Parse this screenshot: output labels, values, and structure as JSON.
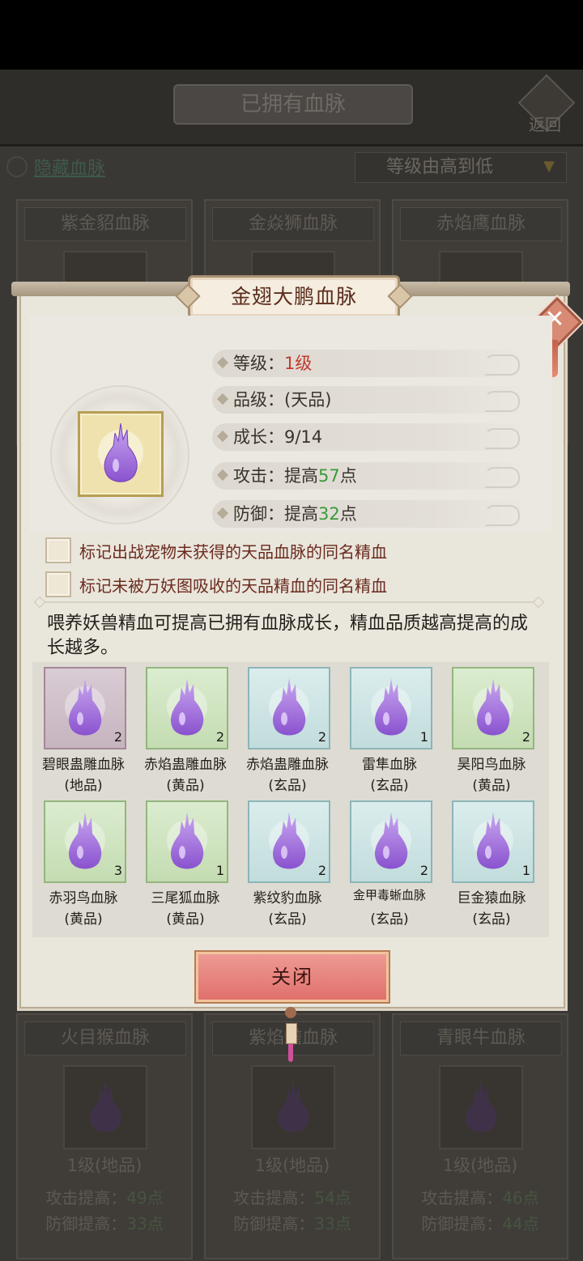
{
  "background": {
    "title": "已拥有血脉",
    "back_label": "返回",
    "hidden_toggle": "隐藏血脉",
    "sort": "等级由高到低",
    "top_cards": [
      {
        "name": "紫金貂血脉"
      },
      {
        "name": "金焱狮血脉"
      },
      {
        "name": "赤焰鹰血脉"
      }
    ],
    "bottom_cards": [
      {
        "name": "火目猴血脉",
        "level": "1级(地品)",
        "attack": "攻击提高：",
        "attack_val": "49点",
        "defense": "防御提高：",
        "defense_val": "33点"
      },
      {
        "name": "紫焰蟾血脉",
        "level": "1级(地品)",
        "attack": "攻击提高：",
        "attack_val": "54点",
        "defense": "防御提高：",
        "defense_val": "33点"
      },
      {
        "name": "青眼牛血脉",
        "level": "1级(地品)",
        "attack": "攻击提高：",
        "attack_val": "46点",
        "defense": "防御提高：",
        "defense_val": "44点"
      }
    ]
  },
  "modal": {
    "title": "金翅大鹏血脉",
    "stats": {
      "level_label": "等级：",
      "level_value": "1级",
      "grade_label": "品级：",
      "grade_value": "(天品)",
      "growth_label": "成长：",
      "growth_value": "9/14",
      "attack_label": "攻击：",
      "attack_prefix": "提高",
      "attack_value": "57",
      "attack_suffix": "点",
      "defense_label": "防御：",
      "defense_prefix": "提高",
      "defense_value": "32",
      "defense_suffix": "点"
    },
    "checkboxes": [
      "标记出战宠物未获得的天品血脉的同名精血",
      "标记未被万妖图吸收的天品精血的同名精血"
    ],
    "description": "喂养妖兽精血可提高已拥有血脉成长，精血品质越高提高的成长越多。",
    "items": [
      {
        "name": "碧眼蛊雕血脉",
        "grade": "(地品)",
        "count": "2"
      },
      {
        "name": "赤焰蛊雕血脉",
        "grade": "(黄品)",
        "count": "2"
      },
      {
        "name": "赤焰蛊雕血脉",
        "grade": "(玄品)",
        "count": "2"
      },
      {
        "name": "雷隼血脉",
        "grade": "(玄品)",
        "count": "1"
      },
      {
        "name": "昊阳鸟血脉",
        "grade": "(黄品)",
        "count": "2"
      },
      {
        "name": "赤羽鸟血脉",
        "grade": "(黄品)",
        "count": "3"
      },
      {
        "name": "三尾狐血脉",
        "grade": "(黄品)",
        "count": "1"
      },
      {
        "name": "紫纹豹血脉",
        "grade": "(玄品)",
        "count": "2"
      },
      {
        "name": "金甲毒蜥血脉",
        "grade": "(玄品)",
        "count": "2"
      },
      {
        "name": "巨金猿血脉",
        "grade": "(玄品)",
        "count": "1"
      }
    ],
    "close_button": "关闭"
  },
  "colors": {
    "accent_red": "#c23a2e",
    "accent_green": "#3b9a3b",
    "drop_purple": "#9b6ad6"
  }
}
